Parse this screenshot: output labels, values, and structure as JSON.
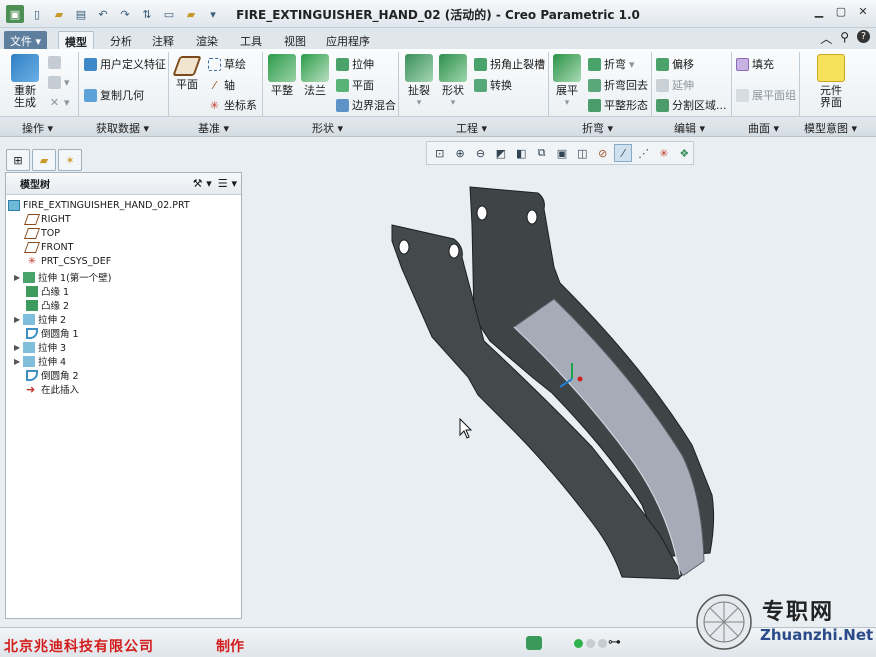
{
  "window": {
    "title": "FIRE_EXTINGUISHER_HAND_02 (活动的) - Creo Parametric 1.0"
  },
  "tabs": {
    "file": "文件",
    "model": "模型",
    "analysis": "分析",
    "annotate": "注释",
    "render": "渲染",
    "tools": "工具",
    "view": "视图",
    "apps": "应用程序"
  },
  "ribbon": {
    "regenerate": "重新生成",
    "udf": "用户定义特征",
    "copy_geom": "复制几何",
    "plane": "平面",
    "sketch": "草绘",
    "axis": "轴",
    "csys": "坐标系",
    "planar": "平整",
    "flange": "法兰",
    "extrude": "拉伸",
    "flat": "平面",
    "blend": "边界混合",
    "rip": "扯裂",
    "form": "形状",
    "corner_relief": "拐角止裂槽",
    "convert": "转换",
    "unbend": "展平",
    "bend": "折弯",
    "bend_back": "折弯回去",
    "flat_state": "平整形态",
    "offset": "偏移",
    "extend": "延伸",
    "split": "分割区域...",
    "fill": "填充",
    "flatten_quilt": "展平面组",
    "component": "元件界面"
  },
  "groups": {
    "ops": "操作",
    "getdata": "获取数据",
    "datum": "基准",
    "shape": "形状",
    "eng": "工程",
    "bend": "折弯",
    "edit": "编辑",
    "surface": "曲面",
    "intent": "模型意图"
  },
  "tree": {
    "header": "模型树",
    "items": [
      {
        "label": "FIRE_EXTINGUISHER_HAND_02.PRT"
      },
      {
        "label": "RIGHT"
      },
      {
        "label": "TOP"
      },
      {
        "label": "FRONT"
      },
      {
        "label": "PRT_CSYS_DEF"
      },
      {
        "label": "拉伸 1(第一个壁)"
      },
      {
        "label": "凸缘 1"
      },
      {
        "label": "凸缘 2"
      },
      {
        "label": "拉伸 2"
      },
      {
        "label": "倒圆角 1"
      },
      {
        "label": "拉伸 3"
      },
      {
        "label": "拉伸 4"
      },
      {
        "label": "倒圆角 2"
      },
      {
        "label": "在此插入"
      }
    ]
  },
  "status": {
    "credit": "北京兆迪科技有限公司",
    "credit2": "制作"
  },
  "watermark": {
    "text": "专职网",
    "url": "Zhuanzhi.Net"
  },
  "colors": {
    "accent": "#5f7f9f",
    "part_dark": "#3f4546",
    "part_face": "#a7aab7",
    "credit_red": "#d21c1c"
  }
}
